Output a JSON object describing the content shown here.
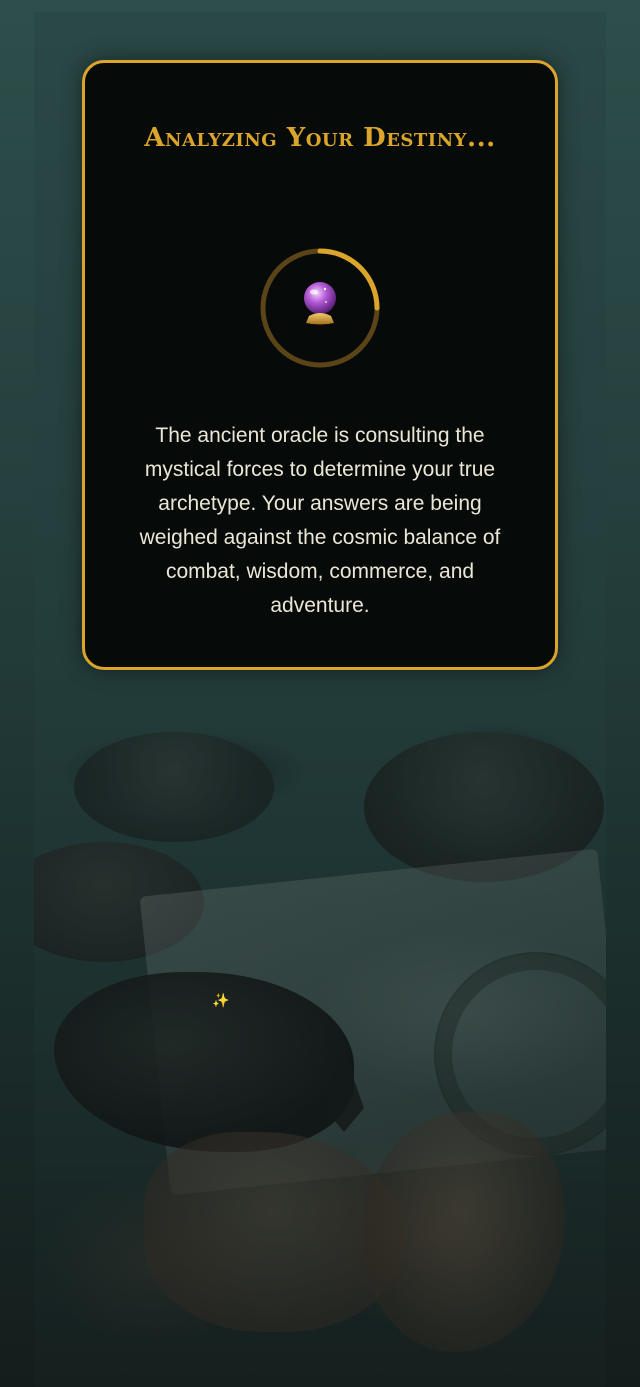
{
  "loading_card": {
    "title": "Analyzing Your Destiny...",
    "description": "The ancient oracle is consulting the mystical forces to determine your true archetype. Your answers are being weighed against the cosmic balance of combat, wisdom, commerce, and adventure.",
    "loader_icon": "crystal-ball-icon"
  },
  "background": {
    "decoration_icon": "sparkle-icon",
    "decoration_glyph": "✨"
  },
  "colors": {
    "accent_gold": "#dba52b",
    "card_background": "#060a09",
    "body_text": "#ece6d6",
    "page_background": "#25403e"
  }
}
